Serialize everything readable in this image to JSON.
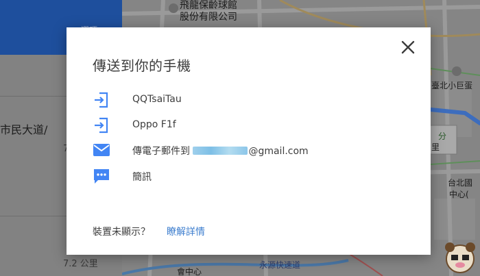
{
  "background": {
    "left_panel": {
      "header_text": "選項",
      "route_title": "市民大道/",
      "distance_1": "7.",
      "distance_2": "7.2 公里"
    },
    "map": {
      "labels": {
        "stadium_1": "飛龍保齡球館",
        "stadium_2": "股份有限公司",
        "taipei_arena": "臺北小巨蛋",
        "route_minutes": "分",
        "route_sub": "里",
        "international_1": "台北國",
        "international_2": "中心(",
        "river": "永源快速道",
        "bottom_left": "會中心"
      }
    }
  },
  "dialog": {
    "title": "傳送到你的手機",
    "close_icon": "close-icon",
    "options": [
      {
        "icon": "send-to-device-icon",
        "label": "QQTsaiTau"
      },
      {
        "icon": "send-to-device-icon",
        "label": "Oppo F1f"
      },
      {
        "icon": "email-icon",
        "label_prefix": "傳電子郵件到 ",
        "label_suffix": "@gmail.com"
      },
      {
        "icon": "sms-icon",
        "label": "簡訊"
      }
    ],
    "footer": {
      "text": "裝置未顯示？",
      "link": "瞭解詳情"
    }
  },
  "colors": {
    "accent": "#3f7fcf",
    "icon_blue": "#4285f4",
    "header_blue": "#1e4f9d",
    "dialog_bg": "#ffffff"
  }
}
